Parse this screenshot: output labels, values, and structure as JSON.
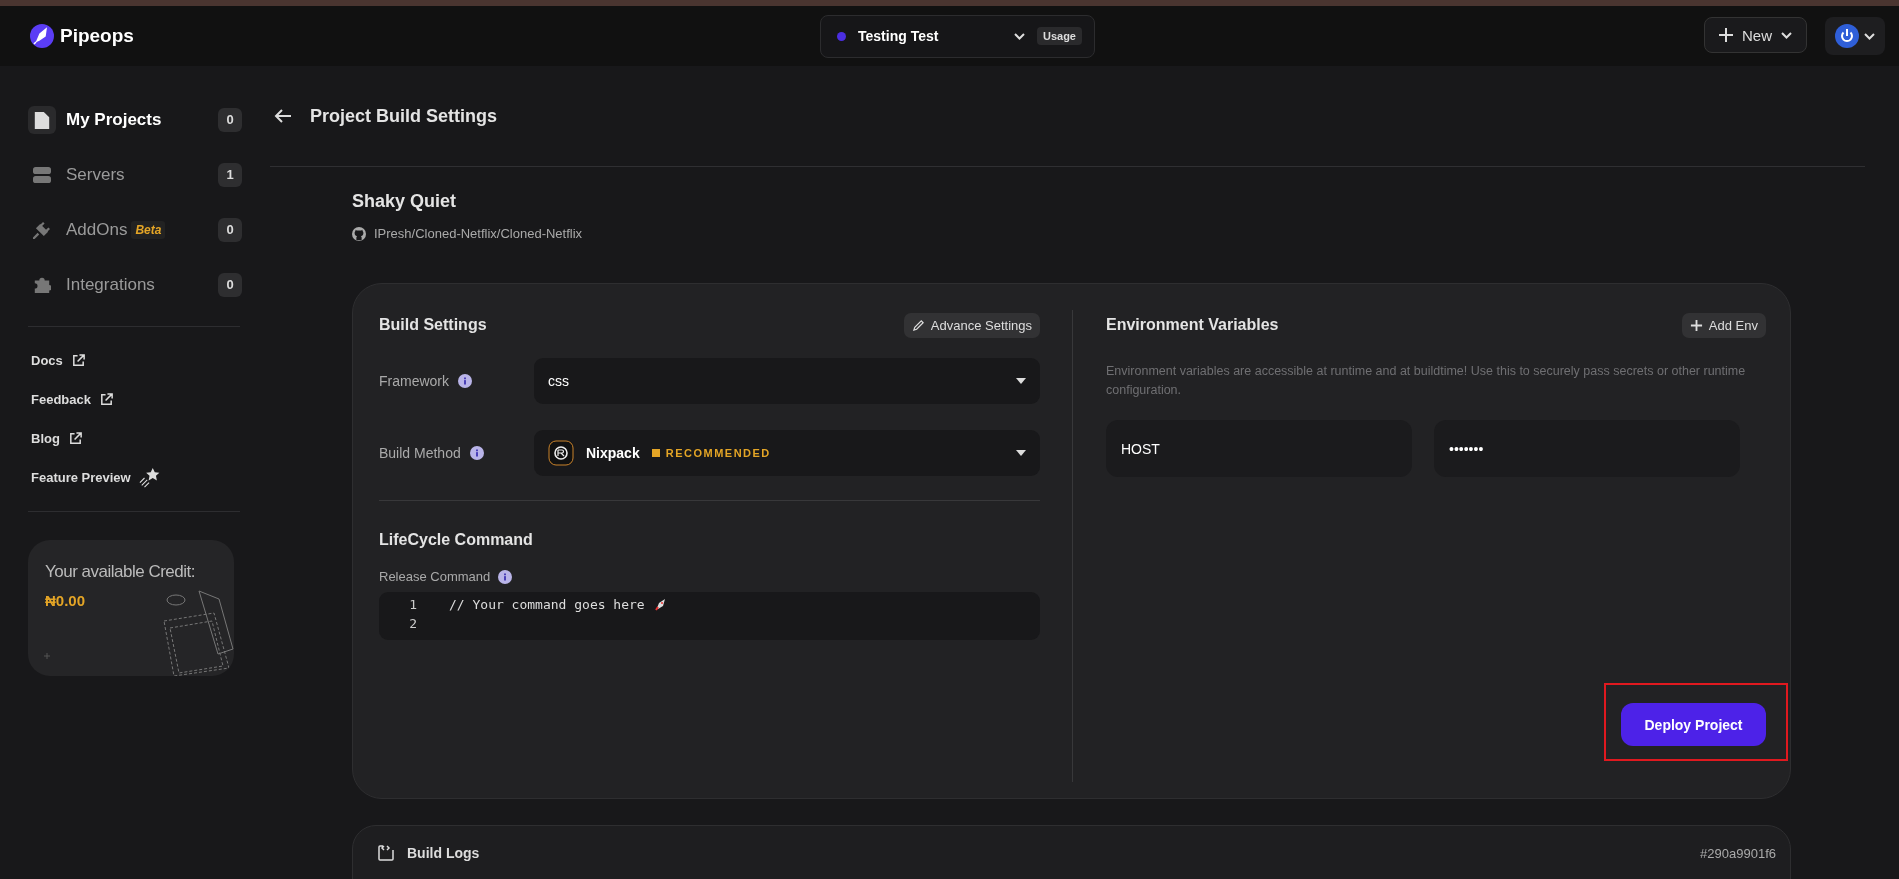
{
  "topbar": {
    "brand": "Pipeops",
    "project_switcher": {
      "name": "Testing Test",
      "badge": "Usage"
    },
    "new_button": "New"
  },
  "sidebar": {
    "items": [
      {
        "label": "My Projects",
        "count": "0",
        "selected": true
      },
      {
        "label": "Servers",
        "count": "1",
        "selected": false
      },
      {
        "label": "AddOns",
        "tag": "Beta",
        "count": "0",
        "selected": false
      },
      {
        "label": "Integrations",
        "count": "0",
        "selected": false
      }
    ],
    "links": [
      {
        "label": "Docs",
        "kind": "external"
      },
      {
        "label": "Feedback",
        "kind": "external"
      },
      {
        "label": "Blog",
        "kind": "external"
      },
      {
        "label": "Feature Preview",
        "kind": "star"
      }
    ],
    "credit": {
      "label": "Your available Credit:",
      "amount": "₦0.00"
    }
  },
  "page": {
    "title": "Project Build Settings",
    "project_name": "Shaky Quiet",
    "repo": "IPresh/Cloned-Netflix/Cloned-Netflix"
  },
  "build_settings": {
    "title": "Build Settings",
    "advance_button": "Advance Settings",
    "framework": {
      "label": "Framework",
      "value": "css"
    },
    "build_method": {
      "label": "Build Method",
      "value": "Nixpack",
      "tag": "RECOMMENDED"
    },
    "lifecycle": {
      "title": "LifeCycle Command",
      "release_label": "Release Command",
      "lines": [
        {
          "number": "1",
          "code": "// Your command goes here"
        },
        {
          "number": "2"
        }
      ]
    }
  },
  "environment": {
    "title": "Environment Variables",
    "add_button": "Add Env",
    "description": "Environment variables are accessible at runtime and at buildtime! Use this to securely pass secrets or other runtime configuration.",
    "variables": [
      {
        "key": "HOST",
        "value": "•••••••"
      }
    ]
  },
  "deploy_button": "Deploy Project",
  "build_logs": {
    "title": "Build Logs",
    "commit": "#290a9901f6"
  }
}
